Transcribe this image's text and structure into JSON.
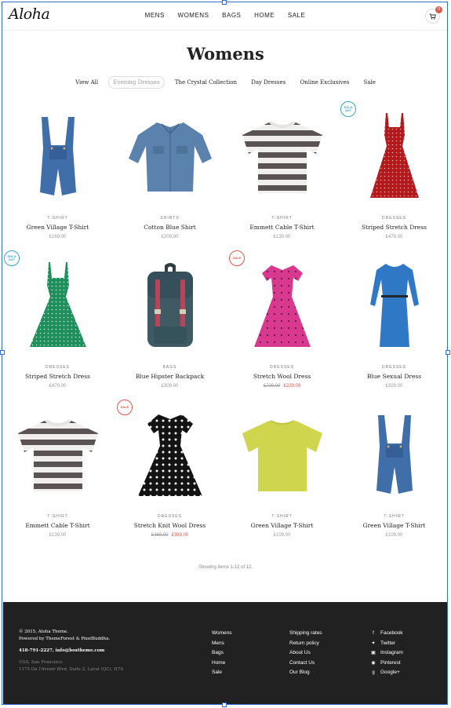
{
  "brand": {
    "logo": "Aloha"
  },
  "nav": [
    "MENS",
    "WOMENS",
    "BAGS",
    "HOME",
    "SALE"
  ],
  "cart": {
    "count": "0",
    "icon": "cart-icon"
  },
  "page_title": "Womens",
  "filters": [
    {
      "label": "View All",
      "active": false
    },
    {
      "label": "Evening Dresses",
      "active": true
    },
    {
      "label": "The Crystal Collection",
      "active": false
    },
    {
      "label": "Day Dresses",
      "active": false
    },
    {
      "label": "Online Exclusives",
      "active": false
    },
    {
      "label": "Sale",
      "active": false
    }
  ],
  "products": [
    {
      "cat": "T-SHIRT",
      "name": "Green Village T-Shirt",
      "price": "£169.00",
      "old": "",
      "badge": "",
      "image": "denim-overalls"
    },
    {
      "cat": "SHIRTS",
      "name": "Cotton Blue Shirt",
      "price": "£209.00",
      "old": "",
      "badge": "",
      "image": "denim-shirt"
    },
    {
      "cat": "T-SHIRT",
      "name": "Emmett Cable T-Shirt",
      "price": "£139.00",
      "old": "",
      "badge": "",
      "image": "striped-tee"
    },
    {
      "cat": "DRESSES",
      "name": "Striped Stretch Dress",
      "price": "£479.00",
      "old": "",
      "badge": "SOLD OUT",
      "image": "red-dress"
    },
    {
      "cat": "DRESSES",
      "name": "Striped Stretch Dress",
      "price": "£479.00",
      "old": "",
      "badge": "SOLD OUT",
      "image": "green-dress"
    },
    {
      "cat": "BAGS",
      "name": "Blue Hipster Backpack",
      "price": "£309.00",
      "old": "",
      "badge": "",
      "image": "backpack"
    },
    {
      "cat": "DRESSES",
      "name": "Stretch Wool Dress",
      "price": "£229.00",
      "old": "£709.00",
      "badge": "SALE",
      "image": "pink-dress"
    },
    {
      "cat": "DRESSES",
      "name": "Blue Sexual Dress",
      "price": "£329.00",
      "old": "",
      "badge": "",
      "image": "blue-dress"
    },
    {
      "cat": "T-SHIRT",
      "name": "Emmett Cable T-Shirt",
      "price": "£139.00",
      "old": "",
      "badge": "",
      "image": "striped-tee"
    },
    {
      "cat": "DRESSES",
      "name": "Stretch Knit Wool Dress",
      "price": "£399.00",
      "old": "£469.00",
      "badge": "SALE",
      "image": "polka-dress"
    },
    {
      "cat": "T-SHIRT",
      "name": "Green Village T-Shirt",
      "price": "£109.00",
      "old": "",
      "badge": "",
      "image": "yellow-tee"
    },
    {
      "cat": "T-SHIRT",
      "name": "Green Village T-Shirt",
      "price": "£109.00",
      "old": "",
      "badge": "",
      "image": "denim-overalls"
    }
  ],
  "showing": "Showing items 1-12 of 12.",
  "footer": {
    "copyright": "© 2015, Aloha Theme.",
    "powered": "Powered by ThemeForest & PixelBuddha.",
    "contact": "418-791-2227, info@boxtheme.com",
    "city": "USA, San Francisco",
    "address": "1175 Du l'Avenir Blvd, Suite 2, Laval (QC), H7S",
    "col1": [
      "Womens",
      "Mens",
      "Bags",
      "Home",
      "Sale"
    ],
    "col2": [
      "Shipping rates",
      "Return policy",
      "About Us",
      "Contact Us",
      "Our Blog"
    ],
    "social": [
      {
        "label": "Facebook",
        "icon": "facebook-icon"
      },
      {
        "label": "Twitter",
        "icon": "twitter-icon"
      },
      {
        "label": "Instagram",
        "icon": "instagram-icon"
      },
      {
        "label": "Pinterest",
        "icon": "pinterest-icon"
      },
      {
        "label": "Google+",
        "icon": "google-plus-icon"
      }
    ]
  }
}
